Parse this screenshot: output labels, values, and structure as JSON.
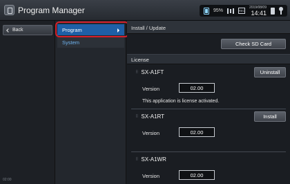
{
  "titlebar": {
    "title": "Program Manager"
  },
  "status": {
    "battery": "95%",
    "date": "2019/08/09",
    "time": "14:41",
    "cal_label": "REC"
  },
  "sidebar": {
    "back_label": "Back",
    "clock": "02:00"
  },
  "menu": {
    "items": [
      {
        "label": "Program",
        "selected": true
      },
      {
        "label": "System",
        "selected": false
      }
    ]
  },
  "main": {
    "header": "Install / Update",
    "check_sd_label": "Check SD Card",
    "section_title": "License",
    "apps": [
      {
        "name": "SX-A1FT",
        "action": "Uninstall",
        "version_label": "Version",
        "version": "02.00",
        "message": "This application is license activated."
      },
      {
        "name": "SX-A1RT",
        "action": "Install",
        "version_label": "Version",
        "version": "02.00"
      },
      {
        "name": "SX-A1WR",
        "version_label": "Version",
        "version": "02.00"
      }
    ]
  },
  "colors": {
    "accent": "#1e5fa6",
    "highlight": "#d6202b",
    "system_text": "#6fb4f0"
  }
}
